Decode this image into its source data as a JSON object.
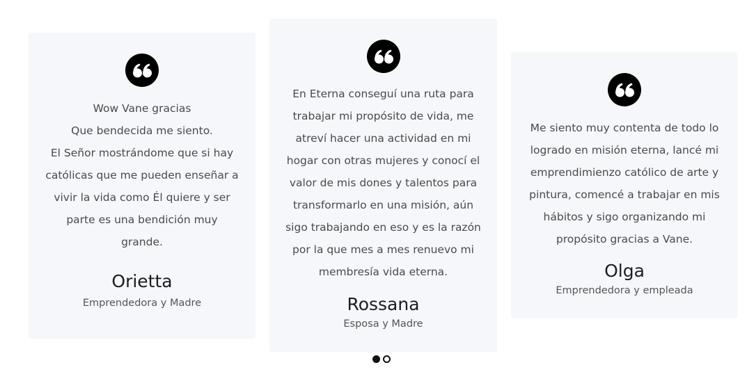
{
  "testimonials": [
    {
      "lines": [
        "Wow Vane gracias",
        "Que bendecida me siento.",
        "El Señor mostrándome que si hay",
        "católicas que me pueden enseñar a",
        "vivir la vida como Él quiere y ser",
        "parte es una bendición muy",
        "grande."
      ],
      "name": "Orietta",
      "role": "Emprendedora y Madre",
      "icon": "quote-icon"
    },
    {
      "lines": [
        "En Eterna conseguí una ruta para",
        "trabajar mi propósito de vida, me",
        "atreví hacer una actividad en mi",
        "hogar con otras mujeres y conocí el",
        "valor de mis dones y talentos para",
        "transformarlo en una misión, aún",
        "sigo trabajando en eso y es la razón",
        "por la que mes a mes renuevo mi",
        "membresía vida eterna."
      ],
      "name": "Rossana",
      "role": "Esposa y Madre",
      "icon": "quote-icon"
    },
    {
      "lines": [
        "Me siento muy contenta de todo lo",
        "logrado en misión eterna, lancé mi",
        "emprendimienzo católico de arte y",
        "pintura, comencé a trabajar en mis",
        "hábitos y sigo organizando mi",
        "propósito gracias a Vane."
      ],
      "name": "Olga",
      "role": "Emprendedora y empleada",
      "icon": "quote-icon"
    }
  ],
  "pagination": {
    "total": 2,
    "active": 0
  },
  "colors": {
    "card_background": "#f6f7fb",
    "icon": "#000000",
    "text": "#4a4a4a",
    "name": "#1d1d1f"
  }
}
